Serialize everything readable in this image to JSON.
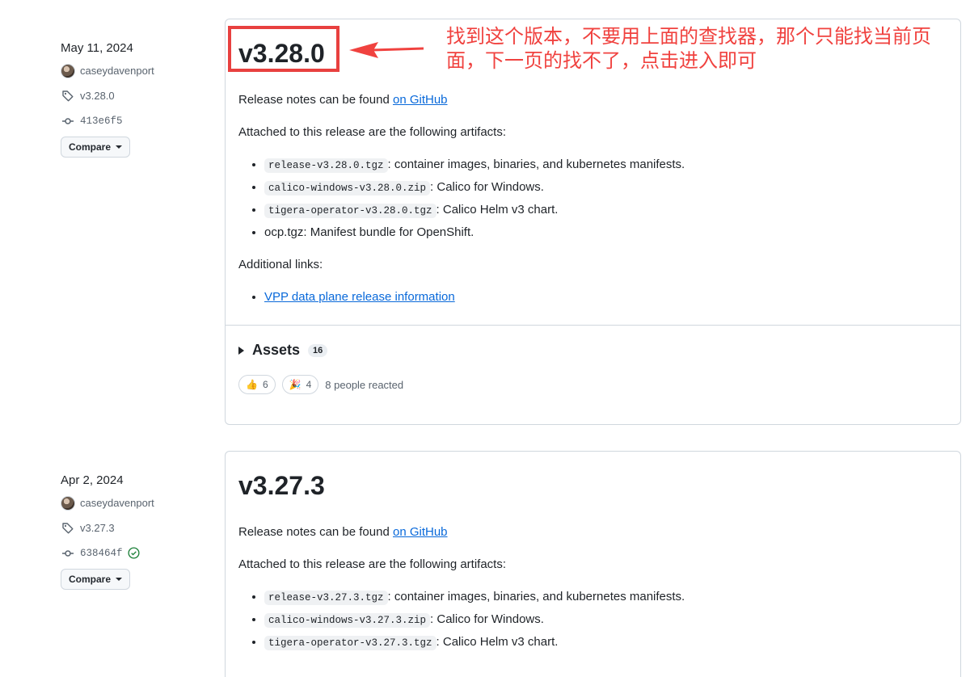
{
  "releases": [
    {
      "date": "May 11, 2024",
      "author": "caseydavenport",
      "tag": "v3.28.0",
      "commit": "413e6f5",
      "compare_label": "Compare",
      "title": "v3.28.0",
      "notes_prefix": "Release notes can be found",
      "notes_link": "on GitHub",
      "attached_text": "Attached to this release are the following artifacts:",
      "artifacts": [
        {
          "code": "release-v3.28.0.tgz",
          "desc": ": container images, binaries, and kubernetes manifests."
        },
        {
          "code": "calico-windows-v3.28.0.zip",
          "desc": ": Calico for Windows."
        },
        {
          "code": "tigera-operator-v3.28.0.tgz",
          "desc": ": Calico Helm v3 chart."
        },
        {
          "text": "ocp.tgz: Manifest bundle for OpenShift."
        }
      ],
      "additional_links_label": "Additional links:",
      "additional_link": "VPP data plane release information",
      "assets_label": "Assets",
      "assets_count": "16",
      "reactions": [
        {
          "emoji": "👍",
          "count": "6"
        },
        {
          "emoji": "🎉",
          "count": "4"
        }
      ],
      "reacted_text": "8 people reacted"
    },
    {
      "date": "Apr 2, 2024",
      "author": "caseydavenport",
      "tag": "v3.27.3",
      "commit": "638464f",
      "compare_label": "Compare",
      "title": "v3.27.3",
      "notes_prefix": "Release notes can be found",
      "notes_link": "on GitHub",
      "attached_text": "Attached to this release are the following artifacts:",
      "artifacts": [
        {
          "code": "release-v3.27.3.tgz",
          "desc": ": container images, binaries, and kubernetes manifests."
        },
        {
          "code": "calico-windows-v3.27.3.zip",
          "desc": ": Calico for Windows."
        },
        {
          "code": "tigera-operator-v3.27.3.tgz",
          "desc": ": Calico Helm v3 chart."
        }
      ]
    }
  ],
  "annotation": {
    "text": "找到这个版本，不要用上面的查找器，那个只能找当前页面，下一页的找不了，点击进入即可",
    "color": "#f0423f"
  }
}
